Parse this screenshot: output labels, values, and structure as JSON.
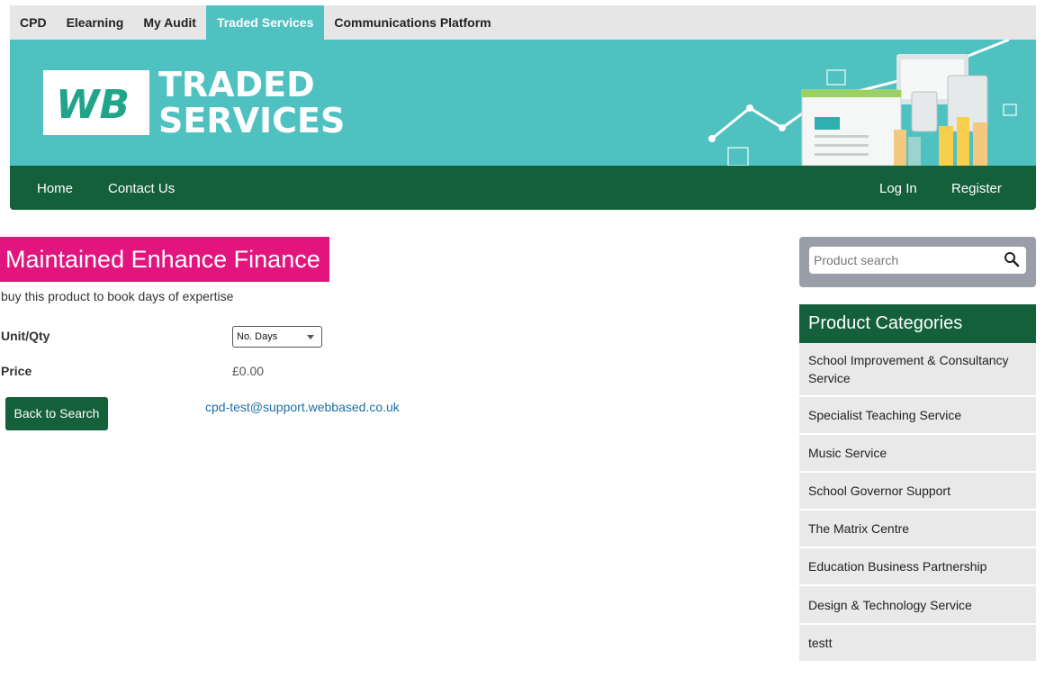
{
  "top_tabs": [
    {
      "label": "CPD"
    },
    {
      "label": "Elearning"
    },
    {
      "label": "My Audit"
    },
    {
      "label": "Traded Services",
      "active": true
    },
    {
      "label": "Communications Platform"
    }
  ],
  "banner": {
    "logo_letters": "WB",
    "title_line1": "TRADED",
    "title_line2": "SERVICES",
    "colors": {
      "banner": "#4fc1c1",
      "logo_green": "#20a58a"
    }
  },
  "nav": {
    "home": "Home",
    "contact": "Contact Us",
    "login": "Log In",
    "register": "Register",
    "color": "#13603a"
  },
  "product": {
    "title": "Maintained Enhance Finance",
    "description": "buy this product to book days of expertise",
    "unit_label": "Unit/Qty",
    "unit_selected": "No. Days",
    "price_label": "Price",
    "price_value": "£0.00",
    "back_button": "Back to Search",
    "email": "cpd-test@support.webbased.co.uk",
    "title_color": "#e2157e"
  },
  "sidebar": {
    "search_placeholder": "Product search",
    "categories_title": "Product Categories",
    "categories": [
      "School Improvement & Consultancy Service",
      "Specialist Teaching Service",
      "Music Service",
      "School Governor Support",
      "The Matrix Centre",
      "Education Business Partnership",
      "Design & Technology Service",
      "testt"
    ]
  }
}
